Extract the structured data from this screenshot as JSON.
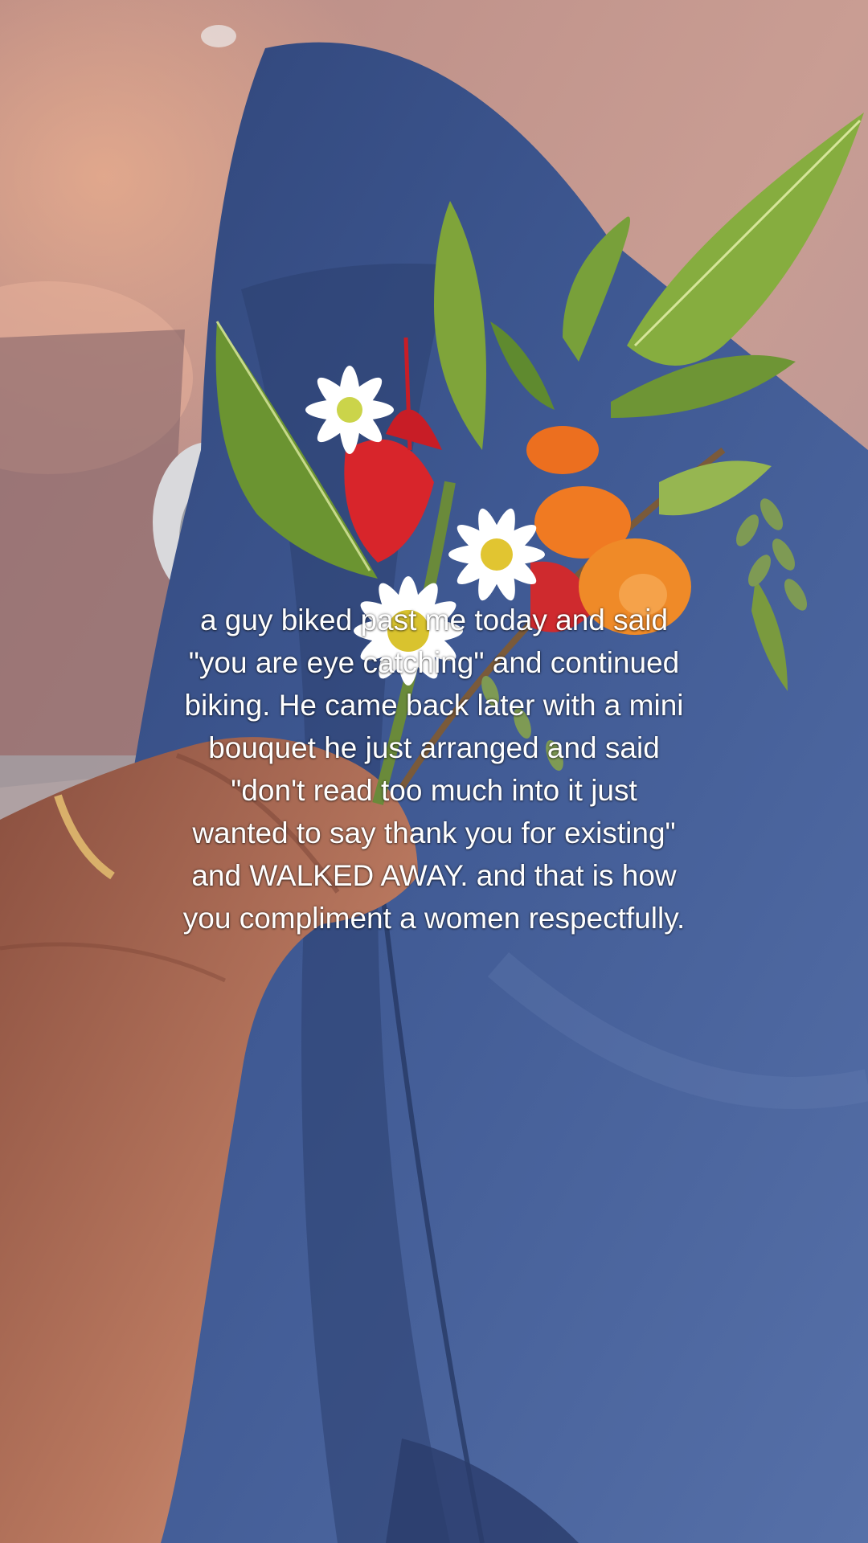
{
  "overlay_text": {
    "lines": [
      "a guy biked past me today and said",
      "\"you are eye catching\" and continued",
      "biking. He came back later with a mini",
      "bouquet he just arranged and said",
      "\"don't read too much into it just",
      "wanted to say thank you for existing\"",
      "and WALKED AWAY. and that is how",
      "you compliment a women respectfully."
    ]
  },
  "colors": {
    "pavement": "#c89a92",
    "denim": "#3d5590",
    "leaf": "#6f9a2e",
    "skin": "#b0705a",
    "text": "#ffffff"
  }
}
